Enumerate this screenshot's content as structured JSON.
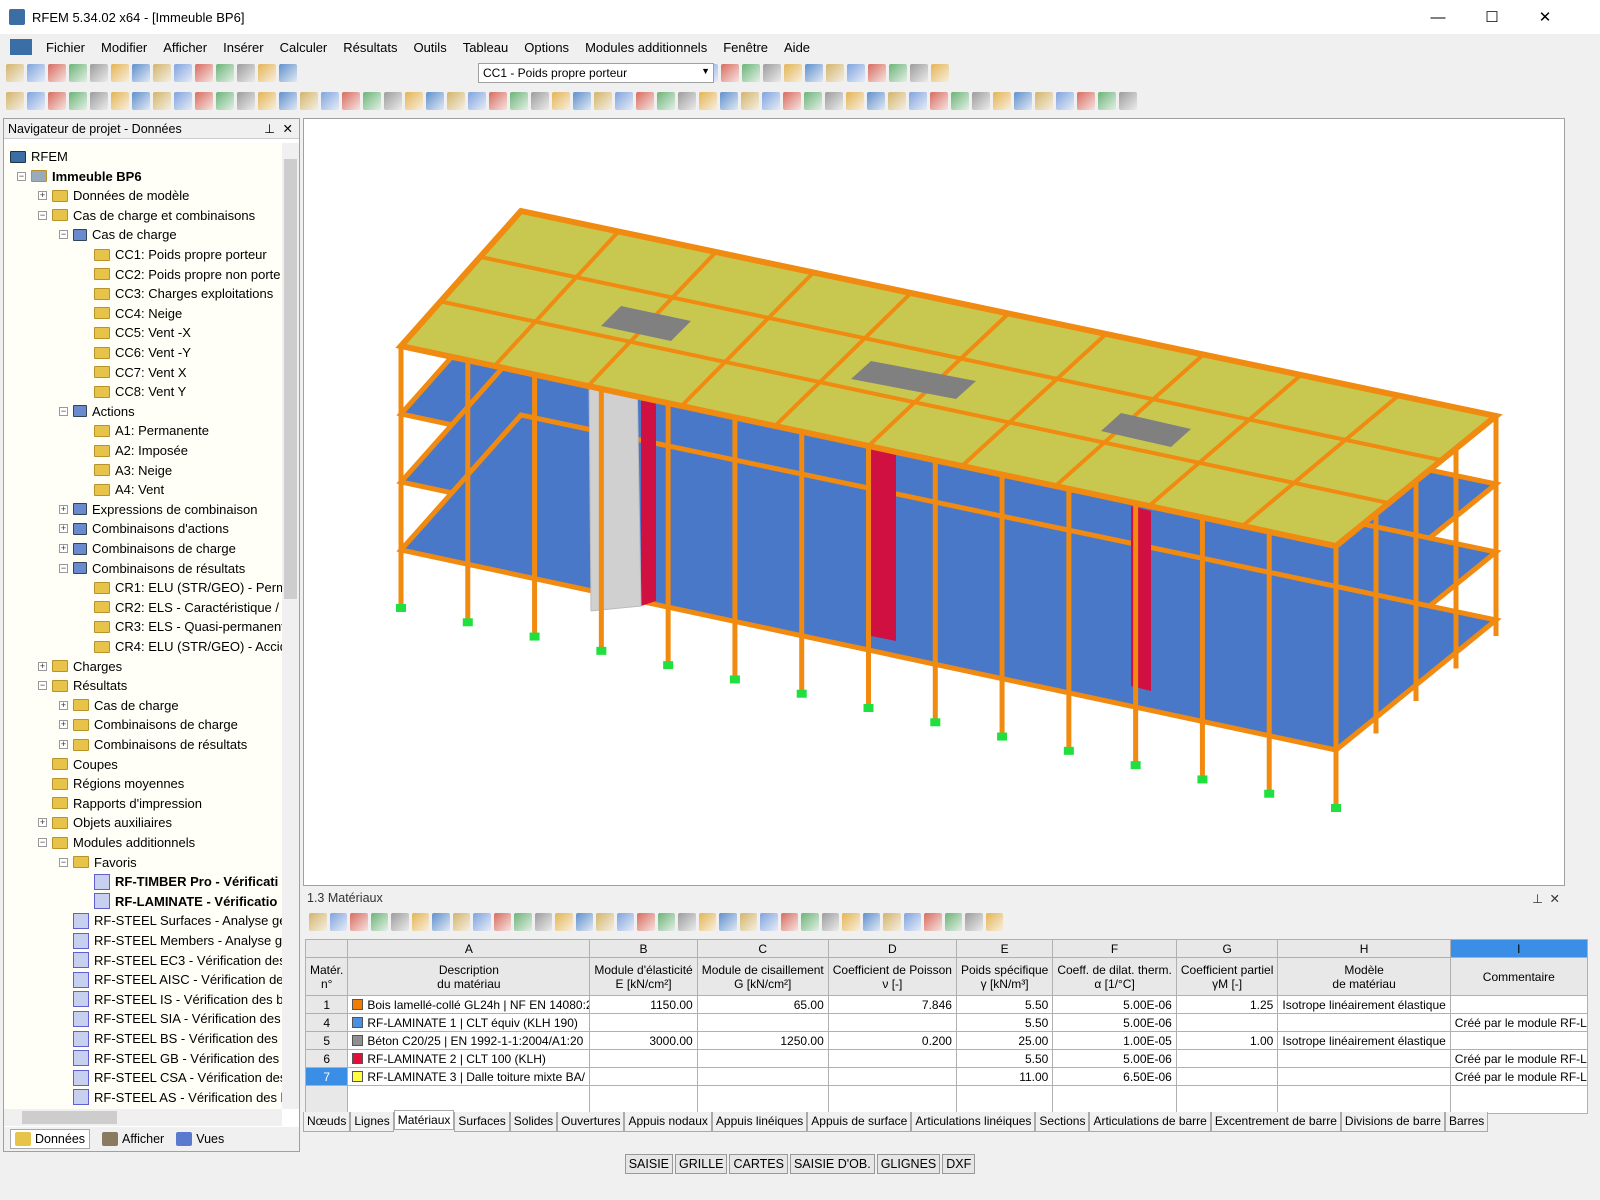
{
  "window": {
    "title": "RFEM 5.34.02 x64 - [Immeuble BP6]",
    "minimize": "—",
    "maximize": "☐",
    "close": "✕"
  },
  "menu": [
    "Fichier",
    "Modifier",
    "Afficher",
    "Insérer",
    "Calculer",
    "Résultats",
    "Outils",
    "Tableau",
    "Options",
    "Modules additionnels",
    "Fenêtre",
    "Aide"
  ],
  "toolbar": {
    "load_case": "CC1 - Poids propre porteur"
  },
  "navigator": {
    "title": "Navigateur de projet - Données",
    "items": [
      {
        "label": "RFEM",
        "level": 0,
        "type": "app"
      },
      {
        "label": "Immeuble BP6",
        "level": 1,
        "type": "model",
        "bold": true,
        "exp": "-"
      },
      {
        "label": "Données de modèle",
        "level": 2,
        "type": "folder",
        "exp": "+"
      },
      {
        "label": "Cas de charge et combinaisons",
        "level": 2,
        "type": "folder",
        "exp": "-"
      },
      {
        "label": "Cas de charge",
        "level": 3,
        "type": "load",
        "exp": "-"
      },
      {
        "label": "CC1: Poids propre porteur",
        "level": 4,
        "type": "folder"
      },
      {
        "label": "CC2: Poids propre non porte",
        "level": 4,
        "type": "folder"
      },
      {
        "label": "CC3: Charges exploitations",
        "level": 4,
        "type": "folder"
      },
      {
        "label": "CC4: Neige",
        "level": 4,
        "type": "folder"
      },
      {
        "label": "CC5: Vent -X",
        "level": 4,
        "type": "folder"
      },
      {
        "label": "CC6: Vent -Y",
        "level": 4,
        "type": "folder"
      },
      {
        "label": "CC7: Vent X",
        "level": 4,
        "type": "folder"
      },
      {
        "label": "CC8: Vent Y",
        "level": 4,
        "type": "folder"
      },
      {
        "label": "Actions",
        "level": 3,
        "type": "load",
        "exp": "-"
      },
      {
        "label": "A1: Permanente",
        "level": 4,
        "type": "folder"
      },
      {
        "label": "A2: Imposée",
        "level": 4,
        "type": "folder"
      },
      {
        "label": "A3: Neige",
        "level": 4,
        "type": "folder"
      },
      {
        "label": "A4: Vent",
        "level": 4,
        "type": "folder"
      },
      {
        "label": "Expressions de combinaison",
        "level": 3,
        "type": "load",
        "exp": "+"
      },
      {
        "label": "Combinaisons d'actions",
        "level": 3,
        "type": "load",
        "exp": "+"
      },
      {
        "label": "Combinaisons de charge",
        "level": 3,
        "type": "load",
        "exp": "+"
      },
      {
        "label": "Combinaisons de résultats",
        "level": 3,
        "type": "load",
        "exp": "-"
      },
      {
        "label": "CR1: ELU (STR/GEO) - Perma",
        "level": 4,
        "type": "folder"
      },
      {
        "label": "CR2: ELS - Caractéristique /",
        "level": 4,
        "type": "folder"
      },
      {
        "label": "CR3: ELS - Quasi-permanent",
        "level": 4,
        "type": "folder"
      },
      {
        "label": "CR4: ELU (STR/GEO) - Accid",
        "level": 4,
        "type": "folder"
      },
      {
        "label": "Charges",
        "level": 2,
        "type": "folder",
        "exp": "+"
      },
      {
        "label": "Résultats",
        "level": 2,
        "type": "folder",
        "exp": "-"
      },
      {
        "label": "Cas de charge",
        "level": 3,
        "type": "folder",
        "exp": "+"
      },
      {
        "label": "Combinaisons de charge",
        "level": 3,
        "type": "folder",
        "exp": "+"
      },
      {
        "label": "Combinaisons de résultats",
        "level": 3,
        "type": "folder",
        "exp": "+"
      },
      {
        "label": "Coupes",
        "level": 2,
        "type": "folder"
      },
      {
        "label": "Régions moyennes",
        "level": 2,
        "type": "folder"
      },
      {
        "label": "Rapports d'impression",
        "level": 2,
        "type": "folder"
      },
      {
        "label": "Objets auxiliaires",
        "level": 2,
        "type": "folder",
        "exp": "+"
      },
      {
        "label": "Modules additionnels",
        "level": 2,
        "type": "folder",
        "exp": "-"
      },
      {
        "label": "Favoris",
        "level": 3,
        "type": "folder",
        "exp": "-"
      },
      {
        "label": "RF-TIMBER Pro - Vérificati",
        "level": 4,
        "type": "module",
        "bold": true
      },
      {
        "label": "RF-LAMINATE - Vérificatio",
        "level": 4,
        "type": "module",
        "bold": true
      },
      {
        "label": "RF-STEEL Surfaces - Analyse gé",
        "level": 3,
        "type": "module"
      },
      {
        "label": "RF-STEEL Members - Analyse ge",
        "level": 3,
        "type": "module"
      },
      {
        "label": "RF-STEEL EC3 - Vérification des",
        "level": 3,
        "type": "module"
      },
      {
        "label": "RF-STEEL AISC - Vérification des",
        "level": 3,
        "type": "module"
      },
      {
        "label": "RF-STEEL IS - Vérification des ba",
        "level": 3,
        "type": "module"
      },
      {
        "label": "RF-STEEL SIA - Vérification des b",
        "level": 3,
        "type": "module"
      },
      {
        "label": "RF-STEEL BS - Vérification des b",
        "level": 3,
        "type": "module"
      },
      {
        "label": "RF-STEEL GB - Vérification des b",
        "level": 3,
        "type": "module"
      },
      {
        "label": "RF-STEEL CSA - Vérification des",
        "level": 3,
        "type": "module"
      },
      {
        "label": "RF-STEEL AS - Vérification des b",
        "level": 3,
        "type": "module"
      }
    ],
    "tabs": [
      "Données",
      "Afficher",
      "Vues"
    ]
  },
  "table": {
    "title": "1.3 Matériaux",
    "col_letters": [
      "A",
      "B",
      "C",
      "D",
      "E",
      "F",
      "G",
      "H",
      "I"
    ],
    "headers": [
      [
        "Matér.",
        "n°"
      ],
      [
        "Description",
        "du matériau"
      ],
      [
        "Module d'élasticité",
        "E [kN/cm²]"
      ],
      [
        "Module de cisaillement",
        "G [kN/cm²]"
      ],
      [
        "Coefficient de Poisson",
        "ν [-]"
      ],
      [
        "Poids spécifique",
        "γ [kN/m³]"
      ],
      [
        "Coeff. de dilat. therm.",
        "α [1/°C]"
      ],
      [
        "Coefficient partiel",
        "γM [-]"
      ],
      [
        "Modèle",
        "de matériau"
      ],
      [
        "",
        "Commentaire"
      ]
    ],
    "rows": [
      {
        "no": "1",
        "color": "#f07c00",
        "desc": "Bois lamellé-collé GL24h | NF EN 14080:2",
        "E": "1150.00",
        "G": "65.00",
        "nu": "7.846",
        "gamma": "5.50",
        "alpha": "5.00E-06",
        "gm": "1.25",
        "model": "Isotrope linéairement élastique",
        "comment": ""
      },
      {
        "no": "4",
        "color": "#4a90e2",
        "desc": "RF-LAMINATE 1 | CLT équiv (KLH 190)",
        "E": "",
        "G": "",
        "nu": "",
        "gamma": "5.50",
        "alpha": "5.00E-06",
        "gm": "",
        "model": "",
        "comment": "Créé par le module RF-L"
      },
      {
        "no": "5",
        "color": "#909090",
        "desc": "Béton C20/25 | EN 1992-1-1:2004/A1:20",
        "E": "3000.00",
        "G": "1250.00",
        "nu": "0.200",
        "gamma": "25.00",
        "alpha": "1.00E-05",
        "gm": "1.00",
        "model": "Isotrope linéairement élastique",
        "comment": ""
      },
      {
        "no": "6",
        "color": "#e0103a",
        "desc": "RF-LAMINATE 2 | CLT 100 (KLH)",
        "E": "",
        "G": "",
        "nu": "",
        "gamma": "5.50",
        "alpha": "5.00E-06",
        "gm": "",
        "model": "",
        "comment": "Créé par le module RF-L"
      },
      {
        "no": "7",
        "color": "#ffff40",
        "desc": "RF-LAMINATE 3 | Dalle toiture mixte BA/",
        "E": "",
        "G": "",
        "nu": "",
        "gamma": "11.00",
        "alpha": "6.50E-06",
        "gm": "",
        "model": "",
        "comment": "Créé par le module RF-LA"
      }
    ],
    "tabs": [
      "Nœuds",
      "Lignes",
      "Matériaux",
      "Surfaces",
      "Solides",
      "Ouvertures",
      "Appuis nodaux",
      "Appuis linéiques",
      "Appuis de surface",
      "Articulations linéiques",
      "Sections",
      "Articulations de barre",
      "Excentrement de barre",
      "Divisions de barre",
      "Barres"
    ],
    "active_tab": "Matériaux"
  },
  "status": [
    "SAISIE",
    "GRILLE",
    "CARTES",
    "SAISIE D'OB.",
    "GLIGNES",
    "DXF"
  ]
}
